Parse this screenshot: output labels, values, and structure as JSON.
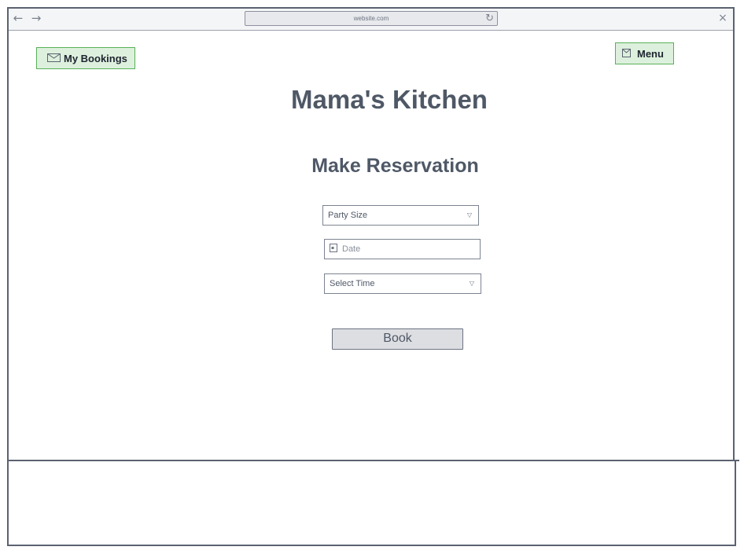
{
  "browser": {
    "url": "website.com",
    "back_icon": "←",
    "forward_icon": "→",
    "reload_icon": "↻",
    "close_icon": "×"
  },
  "header": {
    "bookings_label": "My Bookings",
    "menu_label": "Menu"
  },
  "main": {
    "title": "Mama's Kitchen",
    "subtitle": "Make Reservation",
    "party_size_placeholder": "Party Size",
    "date_placeholder": "Date",
    "time_placeholder": "Select Time",
    "book_label": "Book"
  },
  "colors": {
    "accent_green_bg": "#ddf0dd",
    "accent_green_border": "#58b058",
    "text": "#4f5866",
    "frame": "#5b6270"
  }
}
